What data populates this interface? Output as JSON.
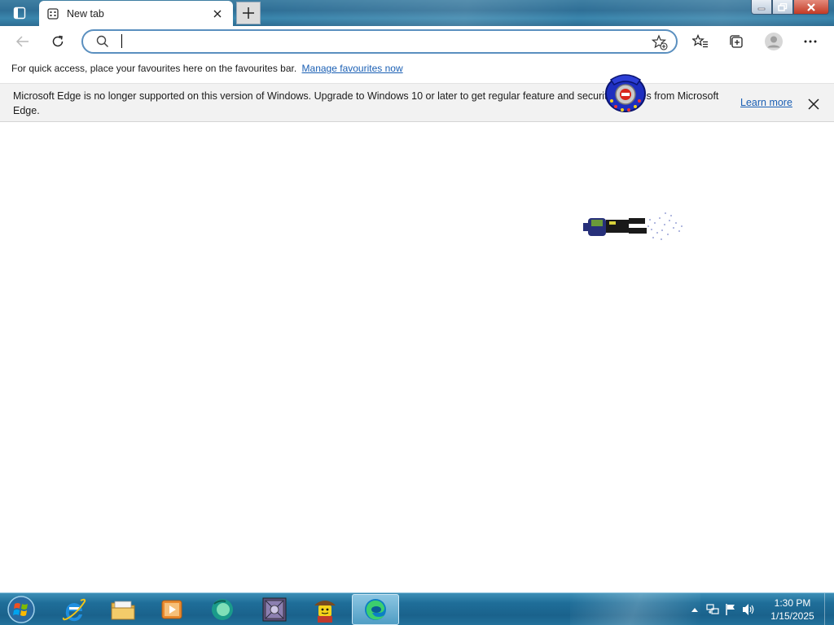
{
  "browser": {
    "tab": {
      "title": "New tab"
    },
    "address_bar": {
      "value": "",
      "placeholder": ""
    },
    "favourites_bar": {
      "text": "For quick access, place your favourites here on the favourites bar.",
      "link": "Manage favourites now"
    },
    "infobar": {
      "message": "Microsoft Edge is no longer supported on this version of Windows. Upgrade to Windows 10 or later to get regular feature and security updates from Microsoft Edge.",
      "link": "Learn more"
    },
    "icons": [
      "vertical-tabs-icon",
      "new-tab-page-icon",
      "close-tab-icon",
      "plus-icon",
      "minimize-icon",
      "maximize-icon",
      "close-window-icon",
      "back-icon",
      "refresh-icon",
      "search-icon",
      "add-favourite-icon",
      "favourites-icon",
      "collections-icon",
      "profile-icon",
      "more-icon"
    ]
  },
  "taskbar": {
    "apps": [
      "internet-explorer",
      "file-explorer",
      "media-player",
      "browser-app",
      "winrar",
      "lego-minifig-app",
      "microsoft-edge"
    ],
    "active_app": "microsoft-edge",
    "clock": {
      "time": "1:30 PM",
      "date": "1/15/2025"
    }
  },
  "colors": {
    "titlebar": "#2f6f96",
    "taskbar": "#1a628c",
    "link": "#1a5fb4",
    "address_border": "#5a8fbf",
    "infobar_bg": "#f2f2f2"
  }
}
